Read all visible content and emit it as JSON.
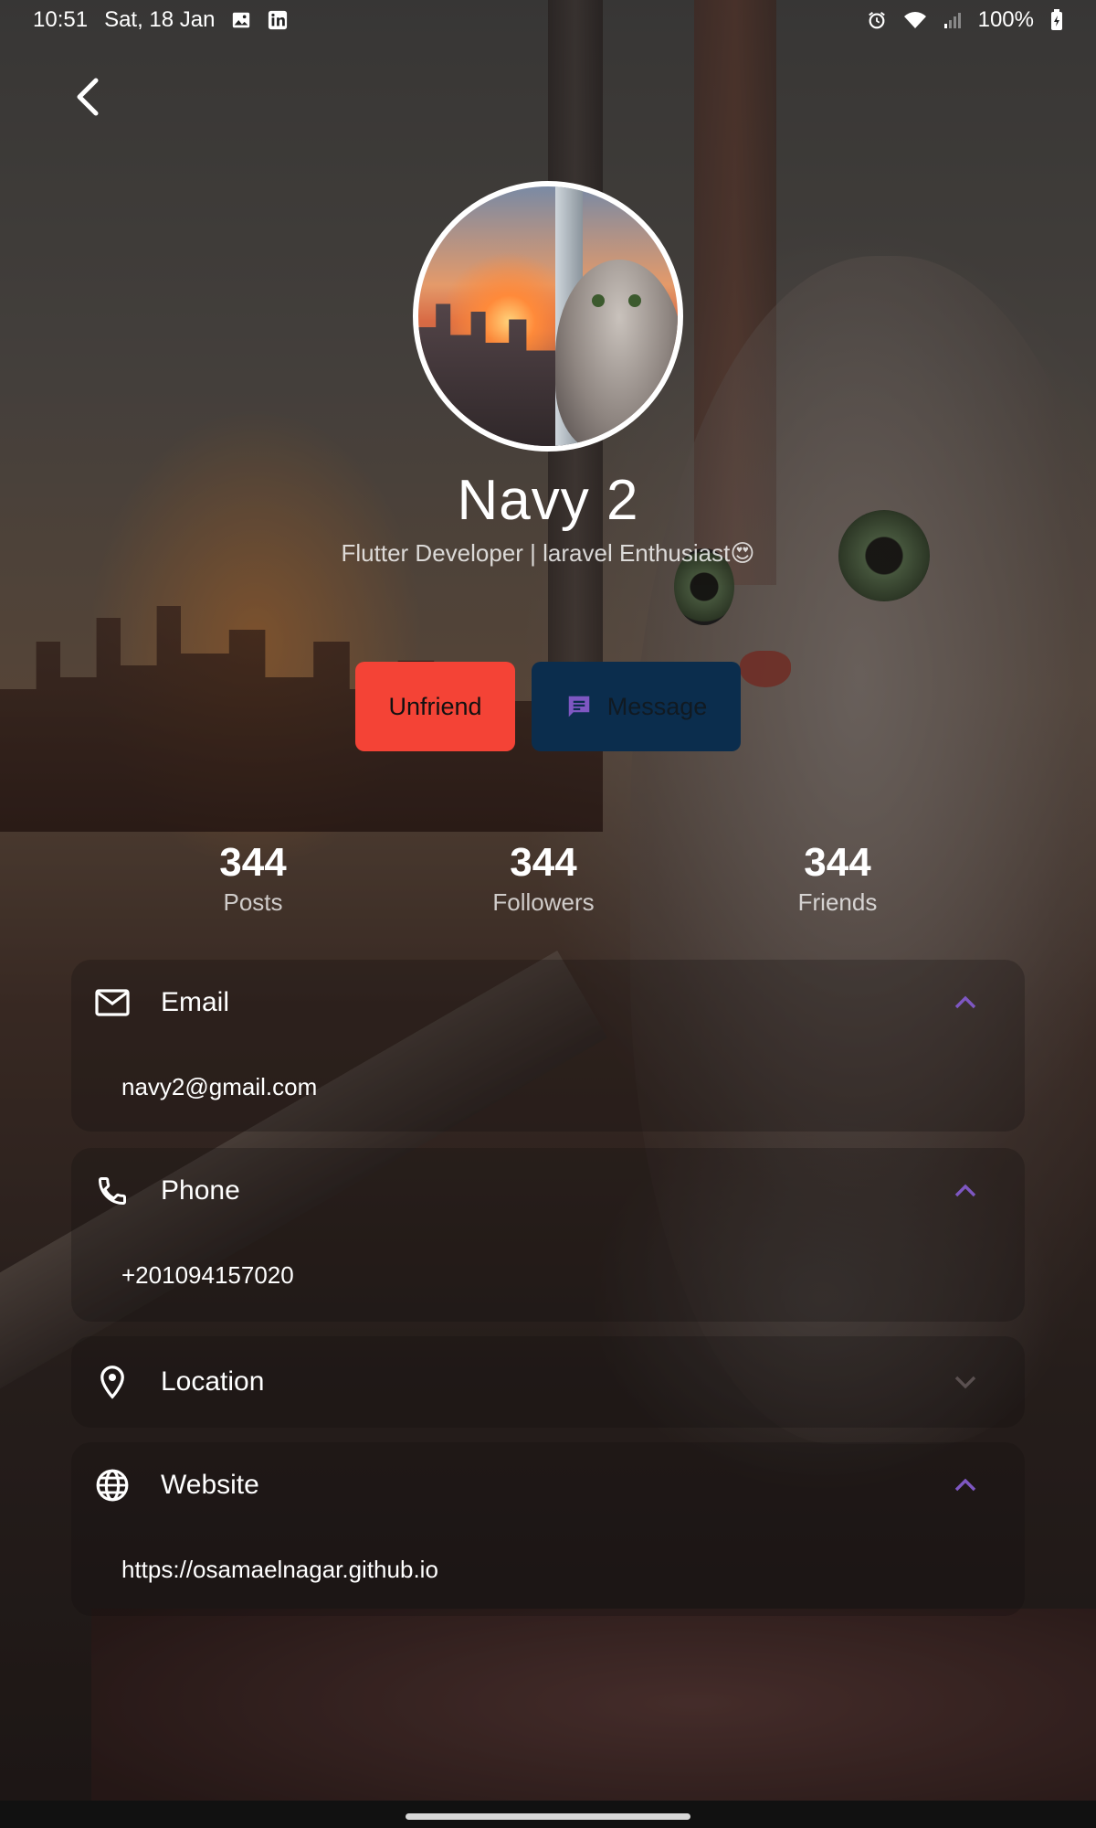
{
  "status_bar": {
    "time": "10:51",
    "date": "Sat, 18 Jan",
    "battery": "100%",
    "icons": [
      "image-icon",
      "linkedin-icon",
      "alarm-icon",
      "wifi-icon",
      "signal-icon",
      "battery-icon"
    ]
  },
  "profile": {
    "name": "Navy 2",
    "bio": "Flutter Developer | laravel Enthusiast😍"
  },
  "actions": {
    "unfriend_label": "Unfriend",
    "message_label": "Message"
  },
  "stats": [
    {
      "value": "344",
      "label": "Posts"
    },
    {
      "value": "344",
      "label": "Followers"
    },
    {
      "value": "344",
      "label": "Friends"
    }
  ],
  "details": {
    "email": {
      "title": "Email",
      "value": "navy2@gmail.com",
      "expanded": true
    },
    "phone": {
      "title": "Phone",
      "value": "+201094157020",
      "expanded": true
    },
    "location": {
      "title": "Location",
      "expanded": false
    },
    "website": {
      "title": "Website",
      "value": "https://osamaelnagar.github.io",
      "expanded": true
    }
  },
  "colors": {
    "unfriend": "#f44336",
    "message": "#0b2d4d",
    "accent": "#7e57c2"
  }
}
